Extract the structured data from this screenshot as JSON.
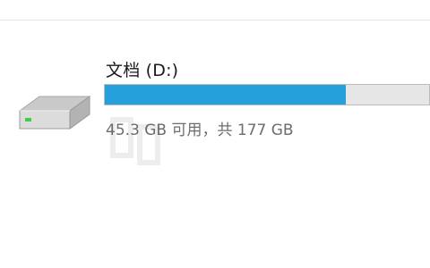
{
  "drive": {
    "name": "文档 (D:)",
    "free_space_text": "45.3 GB 可用，共 177 GB",
    "used_fraction": 0.744,
    "bar_fill_color": "#26a0da",
    "bar_track_color": "#e6e6e6",
    "icon": "hard-drive-icon"
  }
}
